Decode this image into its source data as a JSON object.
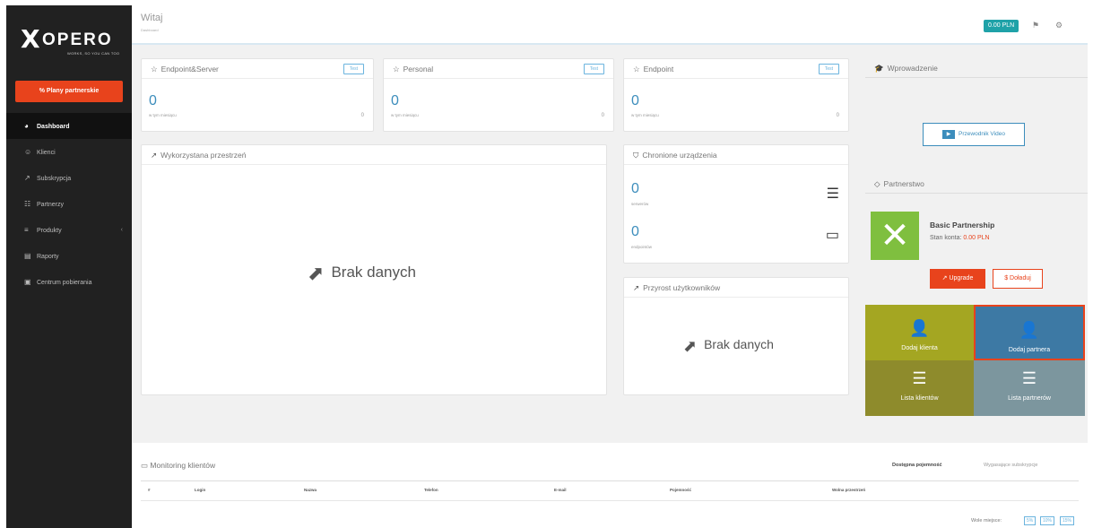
{
  "brand": {
    "mark": "X",
    "name": "OPERO",
    "tagline": "WORKS, SO YOU CAN TOO"
  },
  "sidebar": {
    "plans_button": "Plany partnerskie",
    "items": [
      {
        "label": "Dashboard",
        "icon": "dashboard-icon",
        "active": true
      },
      {
        "label": "Klienci",
        "icon": "clients-icon"
      },
      {
        "label": "Subskrypcja",
        "icon": "chart-icon"
      },
      {
        "label": "Partnerzy",
        "icon": "partners-icon"
      },
      {
        "label": "Produkty",
        "icon": "list-icon",
        "chevron": "‹"
      },
      {
        "label": "Raporty",
        "icon": "reports-icon"
      },
      {
        "label": "Centrum pobierania",
        "icon": "download-icon"
      }
    ]
  },
  "header": {
    "title": "Witaj",
    "subtitle": "Dashboard",
    "balance": "0.00 PLN",
    "icon1": "flag-icon",
    "icon2": "settings-icon"
  },
  "cards": {
    "endpoint_server": {
      "title": "Endpoint&Server",
      "tag": "Test",
      "value": "0",
      "sublabel": "w tym miesiącu",
      "right": "0"
    },
    "personal": {
      "title": "Personal",
      "tag": "Test",
      "value": "0",
      "sublabel": "w tym miesiącu",
      "right": "0"
    },
    "endpoint": {
      "title": "Endpoint",
      "tag": "Test",
      "value": "0",
      "sublabel": "w tym miesiącu",
      "right": "0"
    }
  },
  "usage": {
    "title": "Wykorzystana przestrzeń",
    "nodata": "Brak danych"
  },
  "protected": {
    "title": "Chronione urządzenia",
    "servers_value": "0",
    "servers_label": "serwerów",
    "endpoints_value": "0",
    "endpoints_label": "endpointów"
  },
  "growth": {
    "title": "Przyrost użytkowników",
    "nodata": "Brak danych"
  },
  "intro": {
    "title": "Wprowadzenie",
    "video_button": "Przewodnik Video"
  },
  "partnership": {
    "title": "Partnerstwo",
    "level": "Basic Partnership",
    "balance_label": "Stan konta:",
    "balance_value": "0.00 PLN",
    "upgrade": "Upgrade",
    "topup": "$ Doładuj"
  },
  "tiles": [
    {
      "label": "Dodaj klienta",
      "color": "#a4a622"
    },
    {
      "label": "Dodaj partnera",
      "color": "#3d79a4"
    },
    {
      "label": "Lista klientów",
      "color": "#8e8b2c"
    },
    {
      "label": "Lista partnerów",
      "color": "#7c969e"
    }
  ],
  "monitoring": {
    "title": "Monitoring klientów",
    "tab_active": "Dostępna pojemność",
    "tab_inactive": "Wygasające subskrypcje",
    "columns": [
      "#",
      "Login",
      "Nazwa",
      "Telefon",
      "E-mail",
      "Pojemność",
      "Wolna przestrzeń"
    ],
    "pager_label": "Wole miejsce:",
    "pager": [
      "5%",
      "10%",
      "15%"
    ]
  }
}
